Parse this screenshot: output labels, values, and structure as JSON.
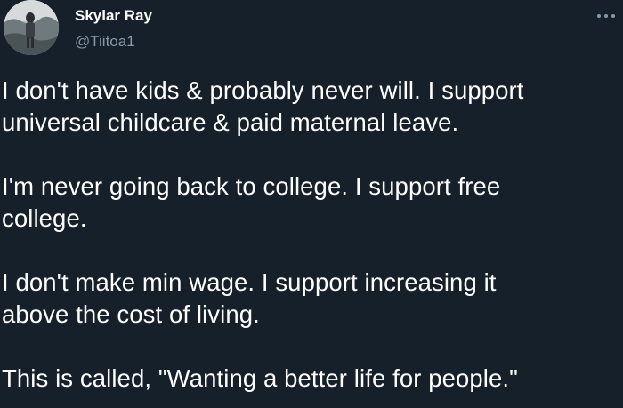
{
  "tweet": {
    "author": {
      "display_name": "Skylar Ray",
      "handle": "@Tiitoa1",
      "avatar_icon": "user-photo-avatar"
    },
    "menu_icon": "more-horizontal-icon",
    "paragraphs": [
      "I don't have kids & probably never will. I support\nuniversal childcare & paid maternal leave.",
      "I'm never going back to college. I support free\ncollege.",
      "I don't make min wage. I support increasing it\nabove the cost of living.",
      "This is called, \"Wanting a better life for people.\""
    ]
  },
  "colors": {
    "background": "#15202b",
    "text_primary": "#ffffff",
    "text_secondary": "#8899a6"
  }
}
